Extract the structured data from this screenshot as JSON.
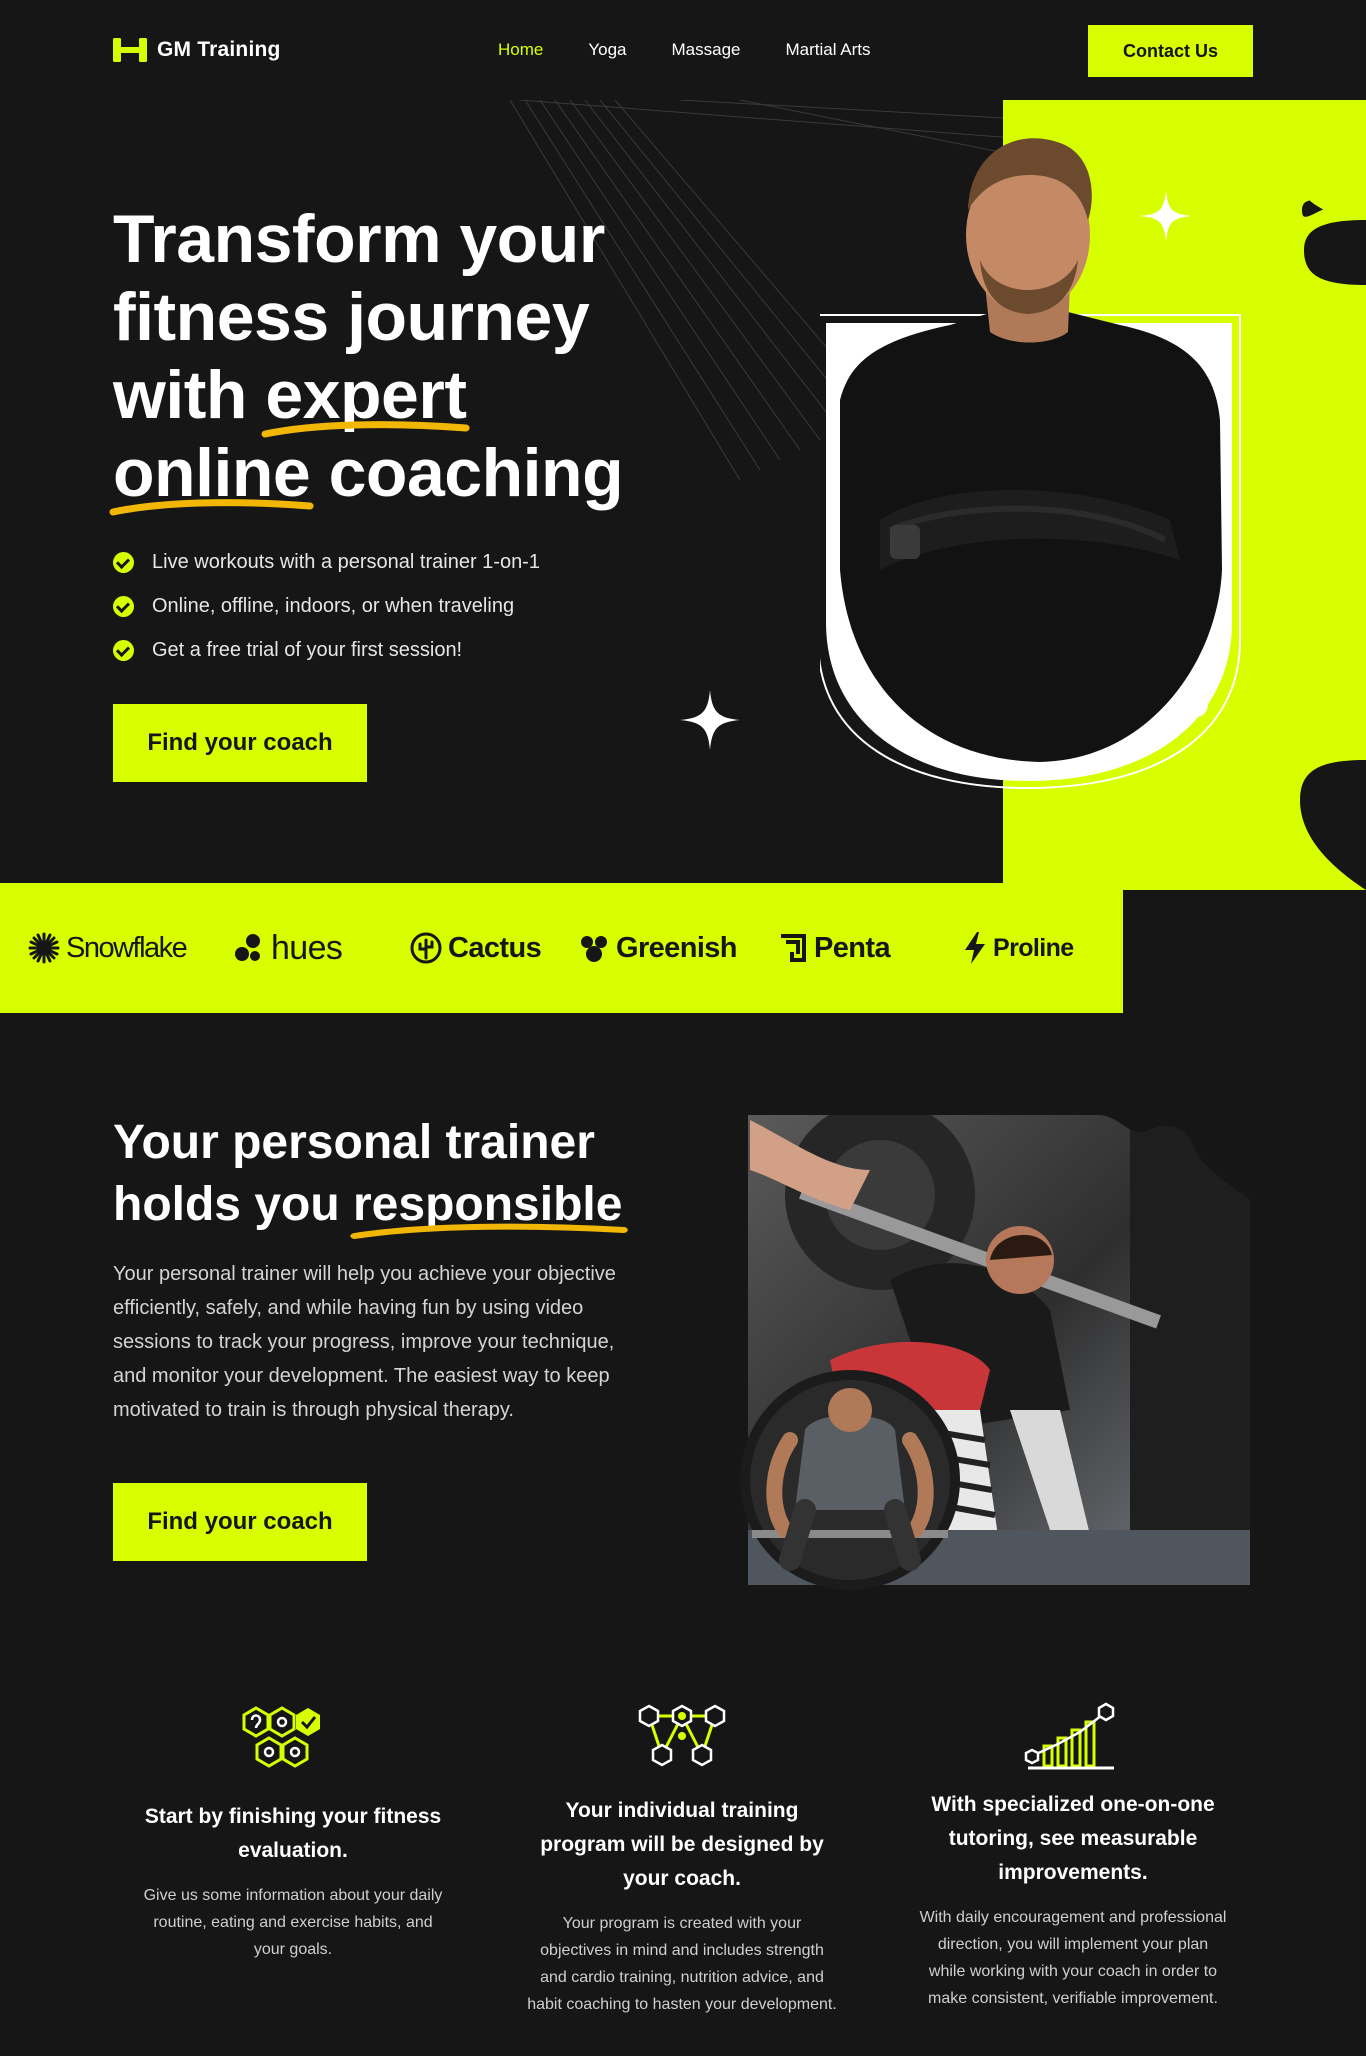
{
  "nav": {
    "brand": "GM Training",
    "items": [
      {
        "label": "Home",
        "active": true
      },
      {
        "label": "Yoga",
        "active": false
      },
      {
        "label": "Massage",
        "active": false
      },
      {
        "label": "Martial Arts",
        "active": false
      }
    ],
    "contact_label": "Contact Us"
  },
  "hero": {
    "title_line1": "Transform your",
    "title_line2": "fitness journey",
    "title_line3_a": "with ",
    "title_line3_b": "expert",
    "title_line4_a": "online",
    "title_line4_b": " coaching",
    "bullets": [
      "Live workouts with a personal trainer 1-on-1",
      "Online, offline, indoors, or when traveling",
      "Get a free trial of your first session!"
    ],
    "cta_label": "Find your coach"
  },
  "brands": [
    {
      "name": "Snowflake",
      "icon": "asterisk-icon"
    },
    {
      "name": "hues",
      "icon": "blob-icon"
    },
    {
      "name": "Cactus",
      "icon": "cactus-icon"
    },
    {
      "name": "Greenish",
      "icon": "clover-icon"
    },
    {
      "name": "Penta",
      "icon": "penta-icon"
    },
    {
      "name": "Proline",
      "icon": "bolt-icon"
    }
  ],
  "section2": {
    "title_line1": "Your personal trainer",
    "title_line2_a": "holds you ",
    "title_line2_b": "responsible",
    "text": "Your personal trainer will help you achieve your objective efficiently, safely, and while having fun by using video sessions to track your progress, improve your technique, and monitor your development. The easiest way to keep motivated to train is through physical therapy.",
    "cta_label": "Find your coach"
  },
  "features": [
    {
      "icon": "hexagons-icon",
      "title": "Start by finishing your fitness evaluation.",
      "text": "Give us some information about your daily routine, eating and exercise habits, and your goals."
    },
    {
      "icon": "network-icon",
      "title": "Your individual training program will be designed by your coach.",
      "text": "Your program is created with your objectives in mind and includes strength and cardio training, nutrition advice, and habit coaching to hasten your development."
    },
    {
      "icon": "growth-chart-icon",
      "title": "With specialized one-on-one tutoring, see measurable improvements.",
      "text": "With daily encouragement and professional direction, you will implement your plan while working with your coach in order to make consistent, verifiable improvement."
    }
  ],
  "colors": {
    "accent": "#d8ff00",
    "background": "#161616",
    "underline": "#f2b705"
  }
}
